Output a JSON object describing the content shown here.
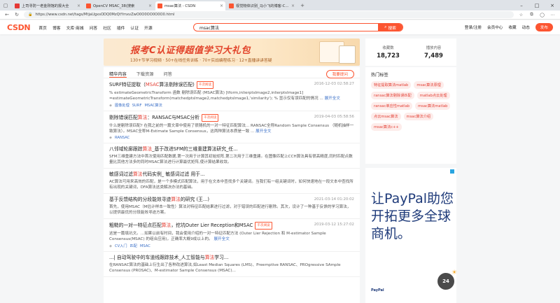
{
  "browser": {
    "tabs": [
      {
        "title": "上司寻防一老金刚馆的报大全",
        "favicon_color": "#e53935",
        "active": false
      },
      {
        "title": "OpenCV MSAC_38(搜索",
        "favicon_color": "#fc5531",
        "active": false
      },
      {
        "title": "msac算法 - CSDN",
        "favicon_color": "#fc5531",
        "active": true
      },
      {
        "title": "视觉物体识别_马小飞的博客-CSDN",
        "favicon_color": "#fc5531",
        "active": false
      }
    ],
    "url": "https://www.csdn.net/tags/MtjaUgxsODQ0MzQtYmxvZwO0O0OO0O0O0.html"
  },
  "header": {
    "logo": "CSDN",
    "nav": [
      "首页",
      "博客",
      "文库·商城",
      "问答",
      "社区",
      "插件",
      "认证",
      "开源"
    ],
    "search_value": "msac算法",
    "search_button": "搜索",
    "right": [
      "登录/注册",
      "会员中心",
      "收藏",
      "动态"
    ],
    "publish": "发布"
  },
  "banner": {
    "headline": "报考C认证得超值学习大礼包",
    "subline": "130+节学习视频 · 50+在线任务训练 · 70+实战编程练习 · 12+直播讲讲答疑"
  },
  "stats": {
    "included_label": "收藏数",
    "included_value": "18,723",
    "views_label": "播放内容",
    "views_value": "7,489"
  },
  "list": {
    "tabs": [
      "精华内容",
      "下载资源",
      "问答"
    ],
    "ask_button": "我要提问",
    "items": [
      {
        "pre": "SURF特征提取（",
        "kw": "MSAC",
        "post": "算法剔除误匹配)",
        "tag": "千次阅读",
        "date": "2016-12-03 02:58:27",
        "desc": "% estimateGeometricTransform 函数 剔除误匹配 (MSAC算法) [tform,inlierptsImage2,inlierptsImage1] =estimateGeometricTransform(matchedptsImage2,matchedptsImage1,'similarity'); % 显示仅有误匹配的情况 ...",
        "more": "展开全文",
        "meta": [
          "图像处理",
          "SURF",
          "MSAC算法"
        ]
      },
      {
        "pre": "剔除错误匹配",
        "kw": "算法",
        "post": "：RANSAC与MSAC分析",
        "tag": "千次阅读",
        "date": "2019-04-03 05:58:56",
        "desc": "什么是剔除误匹配? 在我之前的一篇文章中使用了很随机的一对一特征匹配算法... RANSAC全称Random Sample Consensus （随机抽样一致算法）。MSAC全称M-Estimate Sample Consensus，这两种算法本质是一致 ...",
        "more": "展开全文",
        "meta": [
          "RANSAC"
        ]
      },
      {
        "pre": "八邻域轮廓跟踪",
        "kw": "算法",
        "post": "_基于改进SFM的三维重建算法研究_任...",
        "tag": "",
        "date": "",
        "desc": "SFM三维重建方法中首次使用匹配数据,第一次用于计算其初始矩阵,第二次用于三维重建。在图像匹配上CCH算法具有很高精度,同时匹配点数量比其他方法多的同时MSAC算法进行计算最优矩阵,使计算结果收敛。",
        "more": "",
        "meta": []
      },
      {
        "pre": "敏感词过滤",
        "kw": "算法",
        "post": "代码实例_ 敏感词过滤 用于...",
        "tag": "",
        "date": "",
        "desc": "AC算法可用来高效的匹配，是一个多模式匹配算法，用于在文本中查找多个关键词。当我们有一组关键词时，如何快速地在一段文本中查找所有出现的关键词，DFA算法这类解决办法的基础。",
        "more": "",
        "meta": []
      },
      {
        "pre": "基于反馈结构的分段能效寻迹",
        "kw": "算法",
        "post": "的研究 (王...)",
        "tag": "",
        "date": "2021-03-14 01:20:02",
        "desc": "首先，使用MSAC（M估计样本一致性）算法对特征匹配结果进行过滤，对于错误的匹配进行剔除。其次，设计了一种基于反馈的学习算法，以提供最优的分段能效寻迹方案。",
        "more": "",
        "meta": []
      },
      {
        "pre": "粗糙的一对一特征点匹配",
        "kw": "算法",
        "post": "，挖坑Outer Lier Reception和MSAC",
        "tag": "千次阅读",
        "date": "2019-03-12 15:27:02",
        "desc": "这是一篇填坑文。...如果以前有时间，我会使用介绍的一对一特征匹配方法 (Outer Lier Rejection 和 M-estimator Sample Consensus(MSAC) 的组合应用)，正确率大概9成以上的。",
        "more": "展开全文",
        "meta": [
          "CV入门",
          "匹配",
          "MSAC"
        ]
      },
      {
        "pre": "...| 自动驾驶中的车道线跟踪技术_人工智能与",
        "kw": "算法",
        "post": "学习...",
        "tag": "",
        "date": "",
        "desc": "在RANSAC算法的基础上衍生出了各种改进算法,如Least Median Squares (LMS)、Preemptive RANSAC、PROgressive SAmple Consensus (PROSAC)、M-estimator Sample Consensus (MSAC)...",
        "more": "",
        "meta": []
      }
    ]
  },
  "hot": {
    "title": "热门标签",
    "chips": [
      "特征提取算法matlab",
      "msac算法原理",
      "ransac算法剔除误匹配",
      "matlab点云处理",
      "ransac单应性matlab",
      "msac算法matlab",
      "点云msac算法",
      "msac算法介绍",
      "msac算法c++"
    ]
  },
  "ad": {
    "text": "让PayPal助您开拓更多全球商机。",
    "brand": "PayPal"
  },
  "weather": {
    "temp": "24"
  }
}
